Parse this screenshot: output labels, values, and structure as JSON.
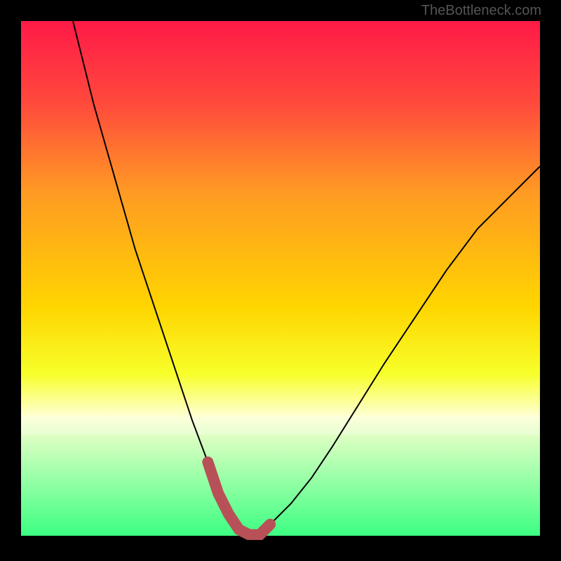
{
  "attribution": "TheBottleneck.com",
  "chart_data": {
    "type": "line",
    "title": "",
    "xlabel": "",
    "ylabel": "",
    "xlim": [
      0,
      100
    ],
    "ylim": [
      0,
      100
    ],
    "series": [
      {
        "name": "bottleneck-curve",
        "x": [
          10,
          14,
          18,
          22,
          26,
          30,
          33,
          36,
          38,
          40,
          42,
          44,
          46,
          48,
          52,
          56,
          60,
          65,
          70,
          76,
          82,
          88,
          94,
          100
        ],
        "y": [
          100,
          84,
          70,
          56,
          44,
          32,
          23,
          15,
          9,
          5,
          2,
          1,
          1,
          3,
          7,
          12,
          18,
          26,
          34,
          43,
          52,
          60,
          66,
          72
        ]
      }
    ],
    "markers": {
      "name": "highlight-segment",
      "x": [
        36,
        38,
        40,
        42,
        44,
        46,
        48
      ],
      "y": [
        15,
        9,
        5,
        2,
        1,
        1,
        3
      ]
    },
    "background_gradient": {
      "stops": [
        {
          "pos": 0.0,
          "color": "#ff1a47"
        },
        {
          "pos": 0.33,
          "color": "#ff9a23"
        },
        {
          "pos": 0.55,
          "color": "#ffd500"
        },
        {
          "pos": 0.76,
          "color": "#feffd0"
        },
        {
          "pos": 0.99,
          "color": "#3cff82"
        }
      ]
    }
  }
}
